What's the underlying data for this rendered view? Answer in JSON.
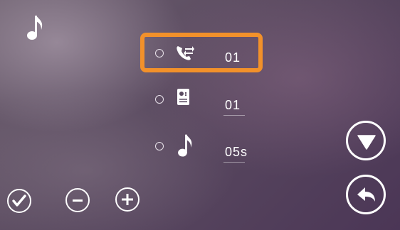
{
  "screen": {
    "music_indicator_icon": "music-note-icon"
  },
  "settings": {
    "items": [
      {
        "icon": "call-forward-icon",
        "value": "01",
        "selected": true
      },
      {
        "icon": "door-station-icon",
        "value": "01",
        "selected": false
      },
      {
        "icon": "music-note-icon",
        "value": "05s",
        "selected": false
      }
    ]
  },
  "controls": {
    "confirm_icon": "check-icon",
    "decrease_icon": "minus-icon",
    "increase_icon": "plus-icon",
    "down_icon": "down-triangle-icon",
    "back_icon": "back-arrow-icon"
  },
  "colors": {
    "highlight": "#f2912a",
    "foreground": "#ffffff"
  }
}
